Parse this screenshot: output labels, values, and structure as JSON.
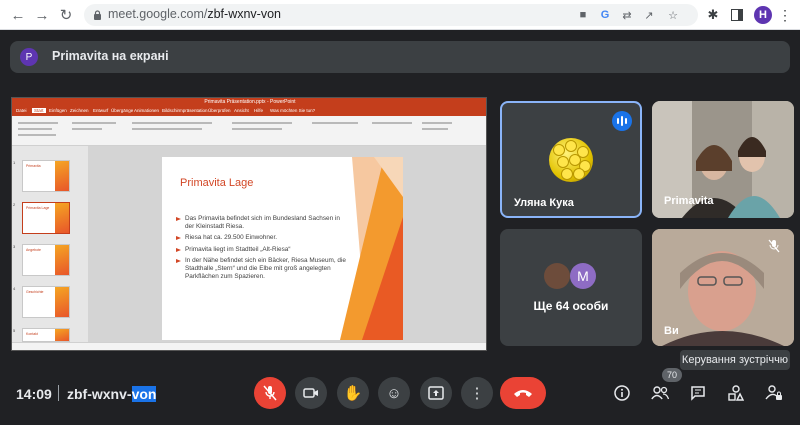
{
  "browser": {
    "url_domain": "meet.google.com/",
    "url_path": "zbf-wxnv-von",
    "profile_initial": "H"
  },
  "banner": {
    "avatar_initial": "P",
    "text": "Primavita на екрані"
  },
  "presentation": {
    "window_title": "Primavita Präsentation.pptx  -  PowerPoint",
    "tabs": [
      "Datei",
      "Start",
      "Einfügen",
      "Zeichnen",
      "Entwurf",
      "Übergänge",
      "Animationen",
      "Bildschirmpräsentation",
      "Überprüfen",
      "Ansicht",
      "Hilfe",
      "Was möchten Sie tun?"
    ],
    "thumbnails": [
      {
        "num": "1",
        "title": "Primavita"
      },
      {
        "num": "2",
        "title": "Primavita Lage"
      },
      {
        "num": "3",
        "title": "Angebote"
      },
      {
        "num": "4",
        "title": "Geschichte"
      },
      {
        "num": "5",
        "title": "Kontakt"
      }
    ],
    "slide": {
      "title": "Primavita Lage",
      "bullets": [
        "Das Primavita befindet sich im Bundesland Sachsen in der Kleinstadt Riesa.",
        "Riesa hat ca. 29.500 Einwohner.",
        "Primavita liegt im Stadtteil „Alt-Riesa“",
        "In der Nähe befindet sich ein Bäcker, Riesa Museum, die Stadthalle „Stern“ und die Elbe mit groß angelegten Parkflächen zum Spazieren."
      ]
    }
  },
  "participants": [
    {
      "name": "Уляна Кука",
      "speaking": true
    },
    {
      "name": "Primavita",
      "speaking": false
    },
    {
      "name": "Ще 64 особи",
      "avatar_initial": "M"
    },
    {
      "name": "Ви",
      "muted": true
    }
  ],
  "tooltip": "Керування зустріччю",
  "bottom": {
    "time": "14:09",
    "code_prefix": "zbf-wxnv-",
    "code_selected": "von",
    "people_count": "70"
  },
  "colors": {
    "accent": "#1a73e8",
    "danger": "#ea4335",
    "slide_accent": "#d24726"
  }
}
